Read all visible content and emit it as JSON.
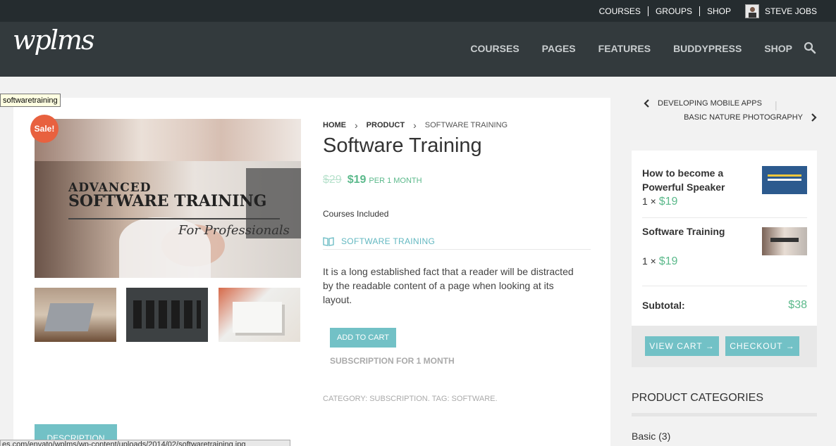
{
  "topbar": {
    "links": [
      "COURSES",
      "GROUPS",
      "SHOP"
    ],
    "user": "STEVE JOBS"
  },
  "header": {
    "logo": "wplms",
    "nav": [
      "COURSES",
      "PAGES",
      "FEATURES",
      "BUDDYPRESS",
      "SHOP"
    ]
  },
  "product": {
    "sale_badge": "Sale!",
    "image_text": {
      "line1": "ADVANCED",
      "line2": "SOFTWARE TRAINING",
      "line3": "For Professionals"
    },
    "breadcrumb": [
      "HOME",
      "PRODUCT",
      "SOFTWARE TRAINING"
    ],
    "title": "Software Training",
    "old_price": "$29",
    "new_price": "$19",
    "price_period": "PER 1 MONTH",
    "courses_label": "Courses Included",
    "course": "SOFTWARE TRAINING",
    "description": "It is a long established fact that a reader will be distracted by the readable content of a page when looking at its layout.",
    "add_to_cart": "ADD TO CART",
    "subscription": "SUBSCRIPTION FOR 1 MONTH",
    "meta": "CATEGORY: SUBSCRIPTION. TAG: SOFTWARE.",
    "description_tab": "DESCRIPTION"
  },
  "tooltip": "softwaretraining",
  "statusbar": "es.com/envato/wplms/wp-content/uploads/2014/02/softwaretraining.jpg",
  "sidebar": {
    "prev": "DEVELOPING MOBILE APPS",
    "next": "BASIC NATURE PHOTOGRAPHY",
    "cart": {
      "items": [
        {
          "name": "How to become a Powerful Speaker",
          "qty": "1 ×",
          "price": "$19"
        },
        {
          "name": "Software Training",
          "qty": "1 ×",
          "price": "$19"
        }
      ],
      "subtotal_label": "Subtotal:",
      "subtotal_value": "$38",
      "view_cart": "VIEW CART →",
      "checkout": "CHECKOUT →"
    },
    "categories_title": "PRODUCT CATEGORIES",
    "category_first": "Basic (3)"
  }
}
